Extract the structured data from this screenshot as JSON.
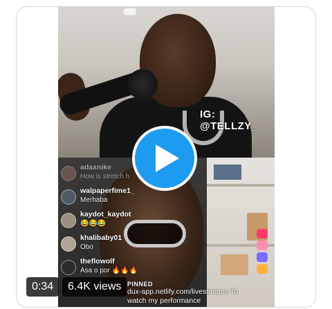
{
  "video": {
    "watermark": "IG: @TELLZY_",
    "duration": "0:34",
    "views": "6.4K views",
    "play_icon": "play-icon"
  },
  "comments": [
    {
      "user": "adaxnike",
      "text": "How is stretch h",
      "faded": true
    },
    {
      "user": "walpaperfime1_",
      "text": "Merhaba"
    },
    {
      "user": "kaydot_kaydot",
      "text": "😂😂😂"
    },
    {
      "user": "khalibaby01",
      "text": "Obo"
    },
    {
      "user": "theflowolf",
      "text": "Asa o por 🔥🔥🔥"
    }
  ],
  "pinned": {
    "label": "PINNED",
    "text_line1": "dux-app.netlify.com/livestreams To",
    "text_line2": "watch my performance"
  },
  "colors": {
    "play_button": "#1d9bf0",
    "card_border": "#cfd9de",
    "badge_bg": "rgba(0,0,0,0.77)"
  }
}
